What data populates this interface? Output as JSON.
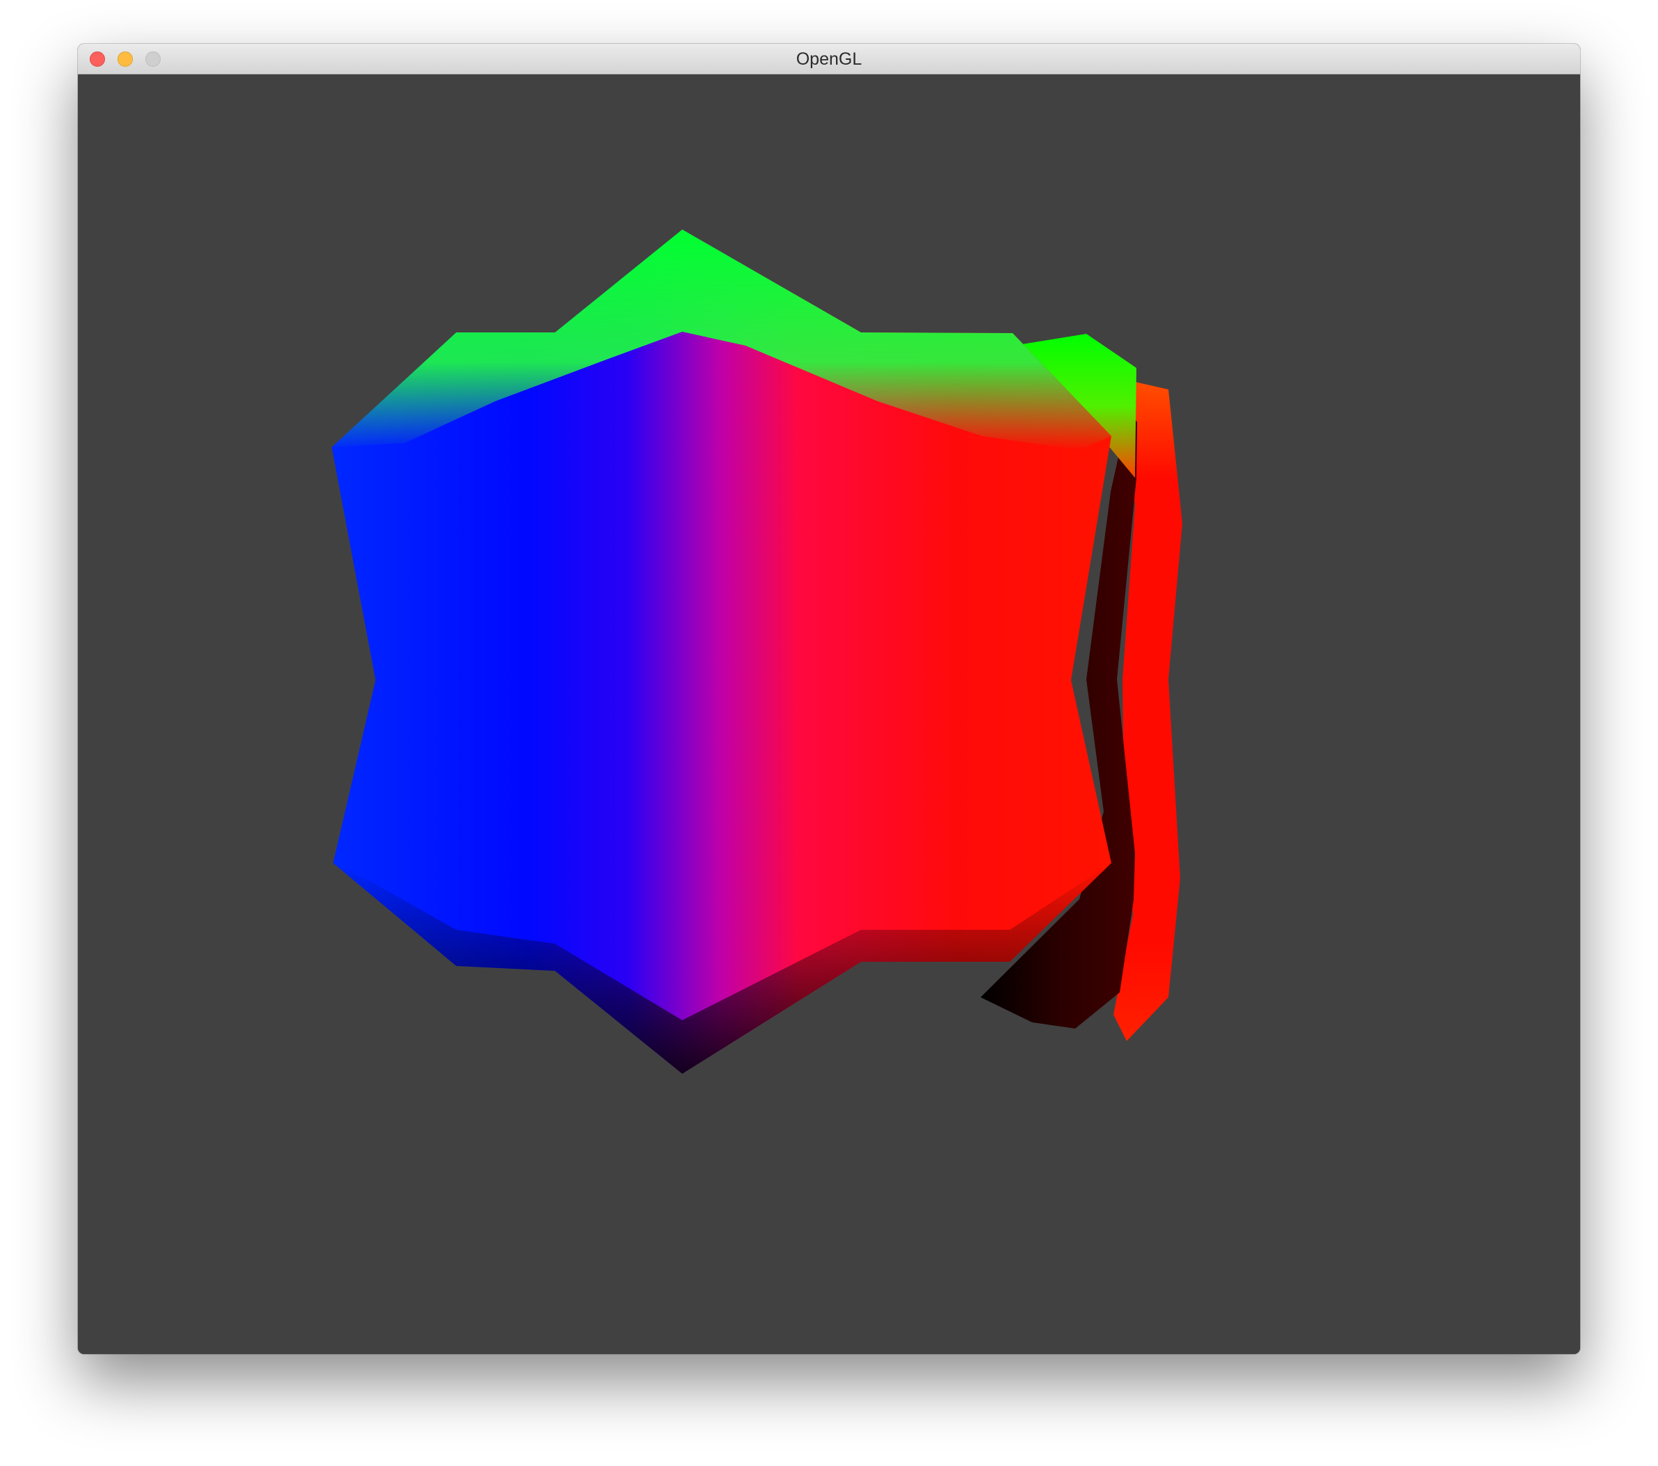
{
  "window": {
    "title": "OpenGL",
    "background_color": "#414141",
    "titlebar_color": "#e0e0e0"
  },
  "titlebar": {
    "buttons": [
      {
        "name": "close",
        "color": "#fc605c"
      },
      {
        "name": "minimize",
        "color": "#fdbc40"
      },
      {
        "name": "zoom",
        "color": "#cfcfcf"
      }
    ]
  },
  "scene": {
    "description_colors": {
      "blue": "#0000ff",
      "red": "#ff0000",
      "green": "#00ff00",
      "magenta": "#d0008a",
      "black": "#000000"
    }
  }
}
